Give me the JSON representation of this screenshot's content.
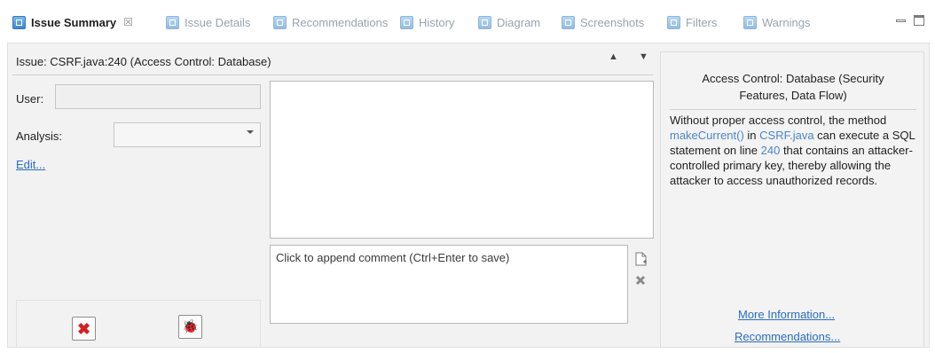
{
  "tabs": [
    {
      "label": "Issue Summary",
      "icon": "issue-summary-icon",
      "active": true,
      "close": "☒"
    },
    {
      "label": "Issue Details",
      "icon": "issue-details-icon",
      "active": false
    },
    {
      "label": "Recommendations",
      "icon": "recommendations-icon",
      "active": false
    },
    {
      "label": "History",
      "icon": "history-icon",
      "active": false
    },
    {
      "label": "Diagram",
      "icon": "diagram-icon",
      "active": false
    },
    {
      "label": "Screenshots",
      "icon": "screenshots-icon",
      "active": false
    },
    {
      "label": "Filters",
      "icon": "filters-icon",
      "active": false
    },
    {
      "label": "Warnings",
      "icon": "warnings-icon",
      "active": false
    }
  ],
  "issue": {
    "title": "Issue:  CSRF.java:240 (Access Control: Database)",
    "arrows": "▲ ▼"
  },
  "form": {
    "user_label": "User:",
    "user_value": "",
    "analysis_label": "Analysis:",
    "analysis_value": "",
    "edit_link": "Edit..."
  },
  "comment": {
    "placeholder": "Click to append comment (Ctrl+Enter to save)"
  },
  "buttons": {
    "delete_icon": "✖",
    "bug_icon": "🐞"
  },
  "right_panel": {
    "title_line1": "Access Control: Database (Security",
    "title_line2": "Features, Data Flow)",
    "desc_part1": "Without proper access control, the method ",
    "method": "makeCurrent()",
    "desc_part2": " in ",
    "file": "CSRF.java",
    "desc_part3": " can execute a SQL statement on line ",
    "line": "240",
    "desc_part4": " that contains an attacker-controlled primary key, thereby allowing the attacker to access unauthorized records.",
    "more_info": "More Information...",
    "recommendations": "Recommendations..."
  },
  "colors": {
    "link": "#2a6cc0",
    "highlight": "#4a86c8",
    "delete_red": "#d42020"
  }
}
